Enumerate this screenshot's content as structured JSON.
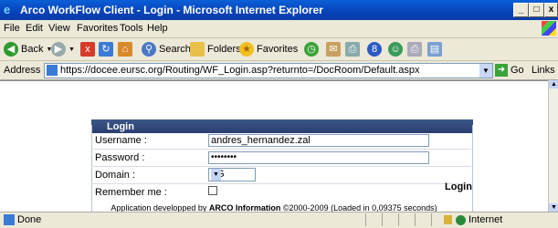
{
  "window": {
    "title": "Arco WorkFlow Client - Login - Microsoft Internet Explorer",
    "minimize": "_",
    "maximize": "□",
    "close": "x"
  },
  "menu": [
    "File",
    "Edit",
    "View",
    "Favorites",
    "Tools",
    "Help"
  ],
  "toolbar": {
    "back": "Back",
    "search": "Search",
    "folders": "Folders",
    "favorites": "Favorites"
  },
  "address": {
    "label": "Address",
    "url": "https://docee.eursc.org/Routing/WF_Login.asp?returnto=/DocRoom/Default.aspx",
    "go": "Go",
    "links": "Links"
  },
  "login": {
    "header": "Login",
    "username_label": "Username :",
    "username_value": "andres_hernandez.zal",
    "password_label": "Password :",
    "password_value": "••••••••",
    "domain_label": "Domain :",
    "domain_value": "LG",
    "remember_label": "Remember me :",
    "button": "Login"
  },
  "footer": {
    "prefix": "Application developped by ",
    "company": "ARCO Information",
    "suffix": " ©2000-2009 (Loaded in 0,09375 seconds)"
  },
  "status": {
    "text": "Done",
    "zone": "Internet"
  }
}
